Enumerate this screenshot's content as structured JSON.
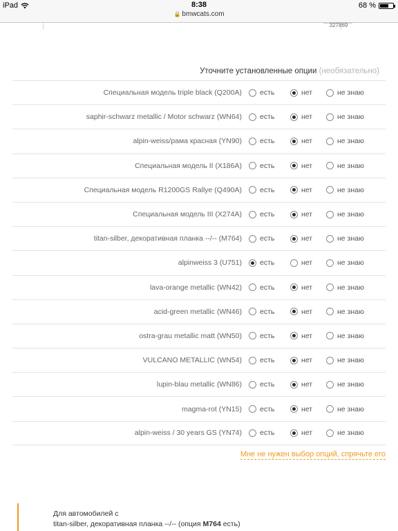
{
  "status_bar": {
    "device": "iPad",
    "time": "8:38",
    "url": "bmwcats.com",
    "battery": "68 %",
    "battery_level": 0.68
  },
  "previous_block": {
    "number": "327869"
  },
  "options_header": {
    "title": "Уточните установленные опции",
    "optional_note": "(необязательно)"
  },
  "choice_labels": {
    "yes": "есть",
    "no": "нет",
    "unknown": "не знаю"
  },
  "options": [
    {
      "label": "Специальная модель triple black (Q200A)",
      "selected": "no"
    },
    {
      "label": "saphir-schwarz metallic / Motor schwarz (WN64)",
      "selected": "no"
    },
    {
      "label": "alpin-weiss/рама красная (YN90)",
      "selected": "no"
    },
    {
      "label": "Специальная модель II (X186A)",
      "selected": "no"
    },
    {
      "label": "Специальная модель R1200GS Rallye (Q490A)",
      "selected": "no"
    },
    {
      "label": "Специальная модель III (X274A)",
      "selected": "no"
    },
    {
      "label": "titan-silber, декоративная планка --/-- (M764)",
      "selected": "no"
    },
    {
      "label": "alpinweiss 3 (U751)",
      "selected": "yes"
    },
    {
      "label": "lava-orange metallic (WN42)",
      "selected": "no"
    },
    {
      "label": "acid-green metallic (WN46)",
      "selected": "no"
    },
    {
      "label": "ostra-grau metallic matt (WN50)",
      "selected": "no"
    },
    {
      "label": "VULCANO METALLIC (WN54)",
      "selected": "no"
    },
    {
      "label": "lupin-blau metallic (WN86)",
      "selected": "no"
    },
    {
      "label": "magma-rot (YN15)",
      "selected": "no"
    },
    {
      "label": "alpin-weiss / 30 years GS (YN74)",
      "selected": "no"
    }
  ],
  "hide_link": "Мне не нужен выбор опций, спрячьте его",
  "note": {
    "line1": "Для автомобилей с",
    "line2_prefix": "titan-silber, декоративная планка --/-- (опция ",
    "line2_code": "M764",
    "line2_suffix": " есть)"
  },
  "colors": {
    "accent": "#ef9a1e",
    "text": "#555555",
    "muted": "#b5b5b5",
    "divider": "#e3e3e3"
  }
}
